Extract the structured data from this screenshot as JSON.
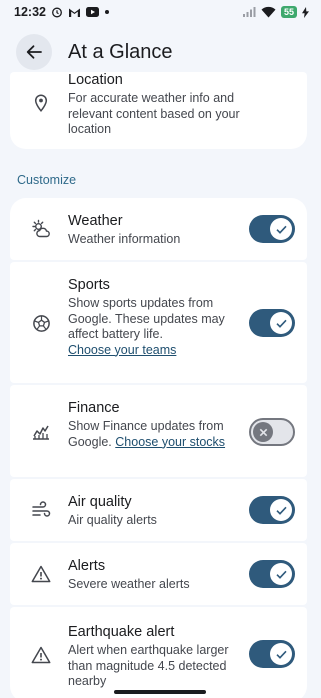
{
  "status_bar": {
    "time": "12:32",
    "battery": "55"
  },
  "app_bar": {
    "title": "At a Glance"
  },
  "location": {
    "title": "Location",
    "description": "For accurate weather info and relevant content based on your location"
  },
  "section": {
    "label": "Customize"
  },
  "items": [
    {
      "title": "Weather",
      "description": "Weather information",
      "enabled": true,
      "icon": "weather-icon"
    },
    {
      "title": "Sports",
      "description": "Show sports updates from Google. These updates may affect battery life.",
      "link": "Choose your teams",
      "enabled": true,
      "icon": "sports-ball-icon"
    },
    {
      "title": "Finance",
      "description": "Show Finance updates from Google.",
      "link": "Choose your stocks",
      "enabled": false,
      "icon": "finance-chart-icon"
    },
    {
      "title": "Air quality",
      "description": "Air quality alerts",
      "enabled": true,
      "icon": "air-quality-icon"
    },
    {
      "title": "Alerts",
      "description": "Severe weather alerts",
      "enabled": true,
      "icon": "warning-icon"
    },
    {
      "title": "Earthquake alert",
      "description": "Alert when earthquake larger than magnitude 4.5 detected nearby",
      "enabled": true,
      "icon": "warning-icon"
    }
  ],
  "colors": {
    "switch_on": "#2f5a7c",
    "accent": "#2f6a8a",
    "background": "#f3f6fb"
  }
}
